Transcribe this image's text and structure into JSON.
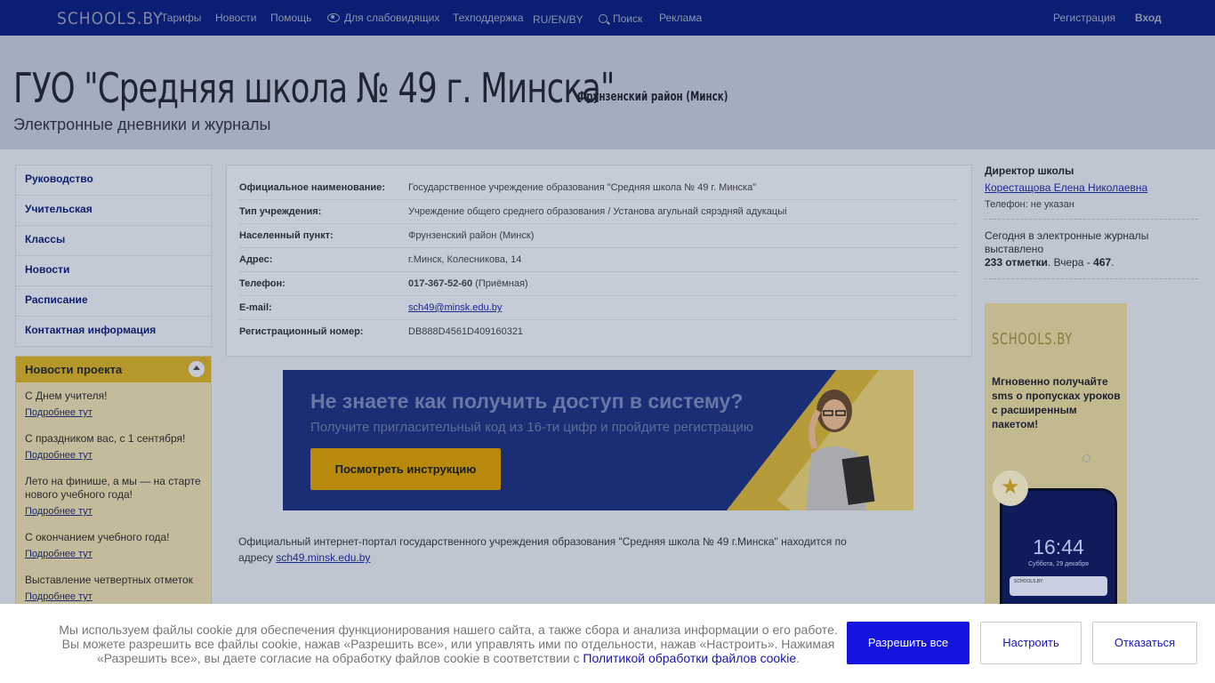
{
  "topnav": {
    "logo": "SCHOOLS.BY",
    "items": [
      "Тарифы",
      "Новости",
      "Помощь",
      "Для слабовидящих",
      "Техподдержка",
      "RU/EN/BY",
      "Поиск",
      "Реклама"
    ],
    "register": "Регистрация",
    "login": "Вход"
  },
  "header": {
    "title": "ГУО \"Средняя школа № 49 г. Минска\"",
    "district": "Фрунзенский район (Минск)",
    "subtitle": "Электронные дневники и журналы"
  },
  "sidebar": {
    "links": [
      "Руководство",
      "Учительская",
      "Классы",
      "Новости",
      "Расписание",
      "Контактная информация"
    ]
  },
  "news": {
    "title": "Новости проекта",
    "more": "Подробнее тут",
    "items": [
      "С Днем учителя!",
      "С праздником вас, с 1 сентября!",
      "Лето на финише, а мы — на старте нового учебного года!",
      "С окончанием учебного года!",
      "Выставление четвертных отметок"
    ]
  },
  "info": {
    "rows": [
      {
        "label": "Официальное наименование:",
        "value": "Государственное учреждение образования \"Средняя школа № 49 г. Минска\""
      },
      {
        "label": "Тип учреждения:",
        "value": "Учреждение общего среднего образования / Установа агульнай сярэдняй адукацыі"
      },
      {
        "label": "Населенный пункт:",
        "value": "Фрунзенский район (Минск)"
      },
      {
        "label": "Адрес:",
        "value": "г.Минск, Колесникова, 14"
      },
      {
        "label": "Телефон:",
        "phone": "017-367-52-60",
        "phone_note": "(Приёмная)"
      },
      {
        "label": "E-mail:",
        "email": "sch49@minsk.edu.by"
      },
      {
        "label": "Регистрационный номер:",
        "value": "DB888D4561D409160321"
      }
    ]
  },
  "banner": {
    "headline": "Не знаете как получить доступ в систему?",
    "sub": "Получите пригласительный код из 16-ти цифр и пройдите регистрацию",
    "button": "Посмотреть инструкцию"
  },
  "portal": {
    "text": "Официальный интернет-портал государственного учреждения образования \"Средняя школа № 49 г.Минска\" находится по адресу",
    "link": "sch49.minsk.edu.by"
  },
  "right": {
    "director_heading": "Директор школы",
    "director_name": "Корестащова Елена Николаевна",
    "phone": "Телефон: не указан",
    "stats_text": "Сегодня в электронные журналы выставлено",
    "stats_today": "233 отметки",
    "stats_yesterday_label": ". Вчера - ",
    "stats_yesterday": "467",
    "stats_end": "."
  },
  "ad": {
    "logo": "SCHOOLS.BY",
    "text": "Мгновенно получайте sms о пропусках уроков с расширенным пакетом!",
    "time": "16:44",
    "date": "Суббота, 29 декабря"
  },
  "cookie": {
    "text": "Мы используем файлы cookie для обеспечения функционирования нашего сайта, а также сбора и анализа информации о его работе. Вы можете разрешить все файлы cookie, нажав «Разрешить все», или управлять ими по отдельности, нажав «Настроить». Нажимая «Разрешить все», вы даете согласие на обработку файлов cookie в соответствии с",
    "link": "Политикой обработки файлов cookie",
    "end": ".",
    "allow": "Разрешить все",
    "configure": "Настроить",
    "decline": "Отказаться"
  }
}
